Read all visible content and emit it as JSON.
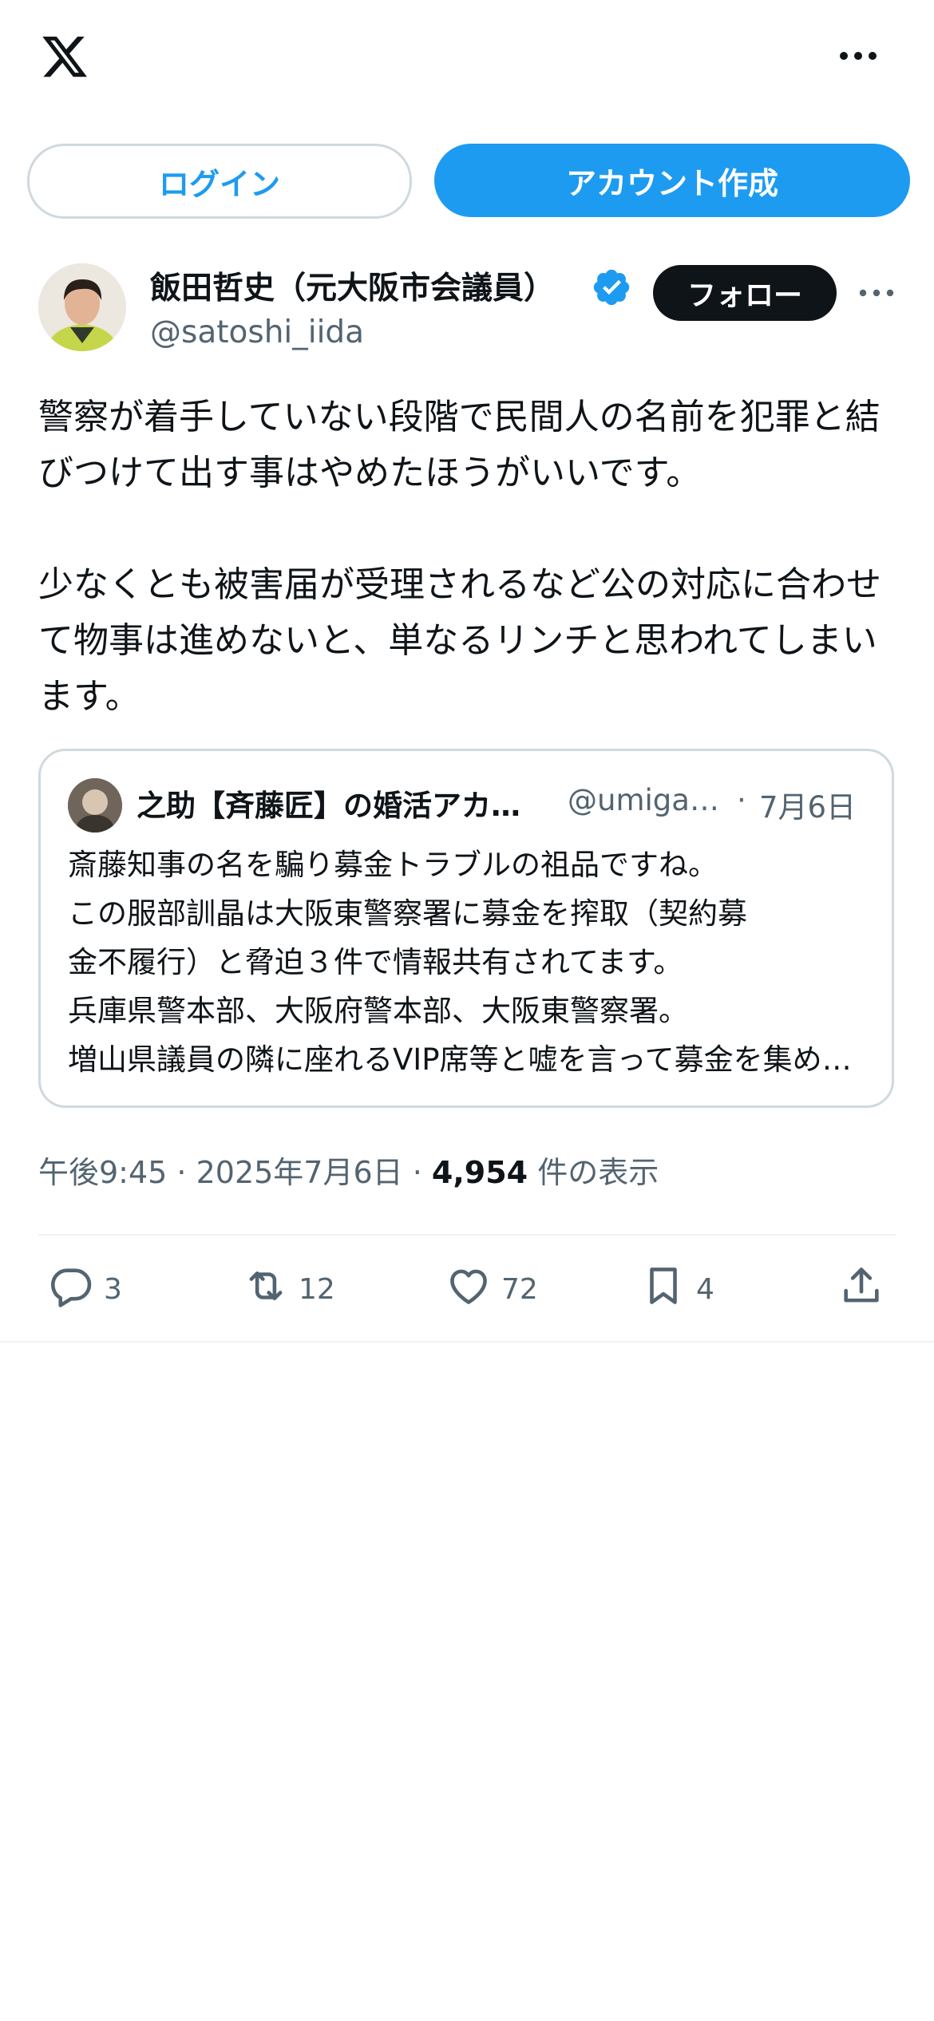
{
  "header": {
    "logo_icon": "x-logo-icon",
    "more_icon": "more-horizontal-icon"
  },
  "auth": {
    "login_label": "ログイン",
    "signup_label": "アカウント作成"
  },
  "author": {
    "name": "飯田哲史（元大阪市会議員）",
    "handle": "@satoshi_iida",
    "verified_icon": "verified-badge-icon",
    "follow_label": "フォロー"
  },
  "tweet": {
    "text": "警察が着手していない段階で民間人の名前を犯罪と結びつけて出す事はやめたほうがいいです。\n\n少なくとも被害届が受理されるなど公の対応に合わせて物事は進めないと、単なるリンチと思われてしまいます。"
  },
  "quote": {
    "name": "之助【斉藤匠】の婚活アカウント",
    "handle": "@umigame",
    "separator": "·",
    "date": "7月6日",
    "lines": [
      "斎藤知事の名を騙り募金トラブルの祖品ですね。",
      "この服部訓晶は大阪東警察署に募金を搾取（契約募",
      "金不履行）と脅迫３件で情報共有されてます。",
      "兵庫県警本部、大阪府警本部、大阪東警察署。",
      "増山県議員の隣に座れるVIP席等と嘘を言って募金を集めていました。"
    ]
  },
  "meta": {
    "time": "午後9:45",
    "sep1": " · ",
    "date": "2025年7月6日",
    "sep2": " · ",
    "views_count": "4,954",
    "views_label": " 件の表示"
  },
  "actions": {
    "reply": {
      "icon": "reply-icon",
      "count": "3"
    },
    "retweet": {
      "icon": "retweet-icon",
      "count": "12"
    },
    "like": {
      "icon": "heart-icon",
      "count": "72"
    },
    "bookmark": {
      "icon": "bookmark-icon",
      "count": "4"
    },
    "share": {
      "icon": "share-icon"
    }
  },
  "colors": {
    "accent": "#1d9bf0",
    "text": "#0f1419",
    "muted": "#536471",
    "border": "#cfd9de"
  }
}
